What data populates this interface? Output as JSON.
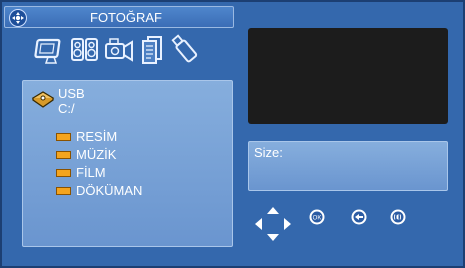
{
  "header": {
    "title": "FOTOĞRAF"
  },
  "toolbar": {
    "items": [
      {
        "icon": "photo-frame-icon"
      },
      {
        "icon": "speakers-icon"
      },
      {
        "icon": "video-camera-icon"
      },
      {
        "icon": "documents-icon"
      },
      {
        "icon": "usb-stick-icon"
      }
    ]
  },
  "browser": {
    "device_label": "USB",
    "path": "C:/",
    "folders": [
      {
        "name": "RESİM"
      },
      {
        "name": "MÜZİK"
      },
      {
        "name": "FİLM"
      },
      {
        "name": "DÖKÜMAN"
      }
    ]
  },
  "info": {
    "size_label": "Size:"
  },
  "controls": {
    "ok_label": "OK",
    "icons": [
      "dpad-icon",
      "ok-icon",
      "back-icon",
      "audio-icon"
    ]
  },
  "colors": {
    "background": "#3468ad",
    "panel": "#7aa3d8",
    "folder": "#f4a41e",
    "preview": "#1c1c1c"
  }
}
